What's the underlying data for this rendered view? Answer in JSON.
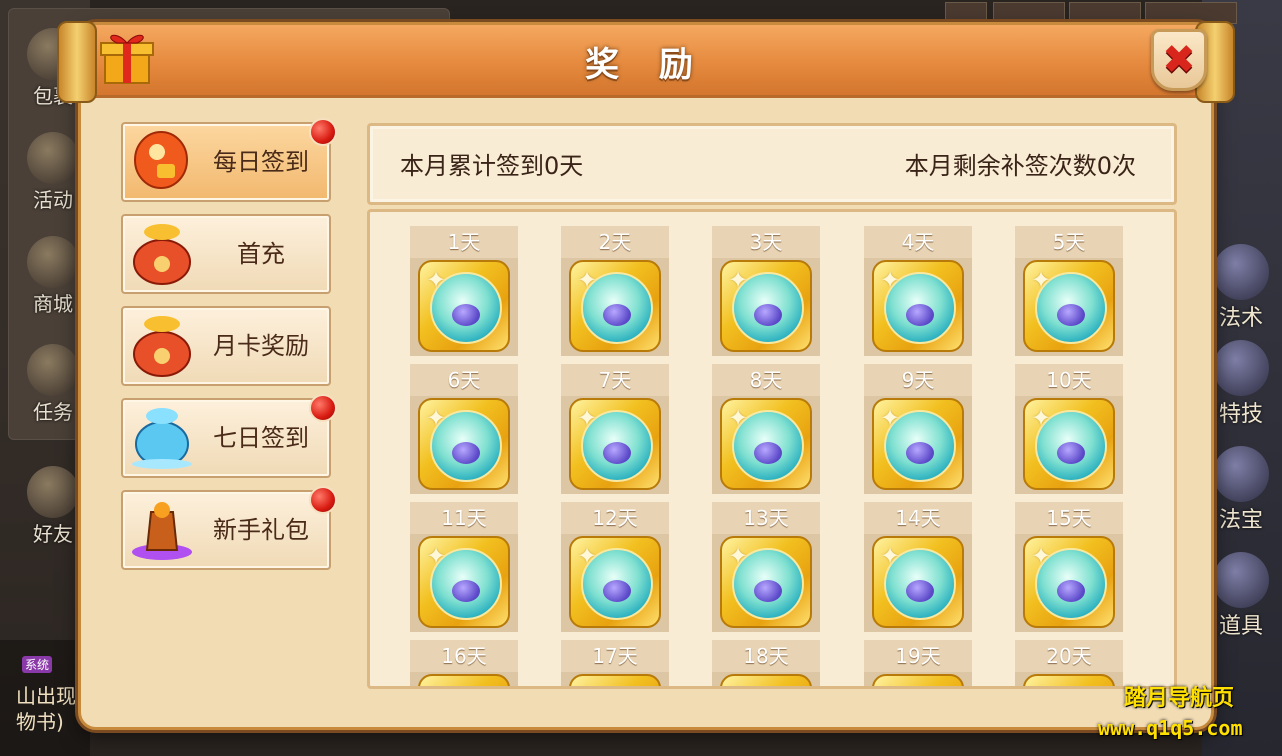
{
  "background": {
    "left_hud": [
      "包裹",
      "活动",
      "商城",
      "任务",
      "好友"
    ],
    "right_hud": [
      "法术",
      "特技",
      "法宝",
      "道具"
    ],
    "chat_tag": "系统",
    "chat_lines": [
      "山出现",
      "物书)"
    ]
  },
  "dialog": {
    "title": "奖 励",
    "close_icon": "close-x-icon"
  },
  "menu": [
    {
      "label": "每日签到",
      "icon": "red-envelope-icon",
      "active": true,
      "badge": true
    },
    {
      "label": "首充",
      "icon": "gold-pouch-icon",
      "active": false,
      "badge": false
    },
    {
      "label": "月卡奖励",
      "icon": "gold-pouch-icon",
      "active": false,
      "badge": false
    },
    {
      "label": "七日签到",
      "icon": "blue-pouch-icon",
      "active": false,
      "badge": true
    },
    {
      "label": "新手礼包",
      "icon": "newbie-gift-icon",
      "active": false,
      "badge": true
    }
  ],
  "info": {
    "monthly_total": "本月累计签到0天",
    "remaining_makeup": "本月剩余补签次数0次"
  },
  "rewards": [
    {
      "day": "1天"
    },
    {
      "day": "2天"
    },
    {
      "day": "3天"
    },
    {
      "day": "4天"
    },
    {
      "day": "5天"
    },
    {
      "day": "6天"
    },
    {
      "day": "7天"
    },
    {
      "day": "8天"
    },
    {
      "day": "9天"
    },
    {
      "day": "10天"
    },
    {
      "day": "11天"
    },
    {
      "day": "12天"
    },
    {
      "day": "13天"
    },
    {
      "day": "14天"
    },
    {
      "day": "15天"
    },
    {
      "day": "16天"
    },
    {
      "day": "17天"
    },
    {
      "day": "18天"
    },
    {
      "day": "19天"
    },
    {
      "day": "20天"
    }
  ],
  "watermark": {
    "line1": "踏月导航页",
    "line2": "www.q1q5.com"
  },
  "colors": {
    "title_bar": "#e58a3e",
    "panel_bg": "#f2dcb4",
    "badge_red": "#d81a10",
    "watermark": "#ffe000"
  }
}
